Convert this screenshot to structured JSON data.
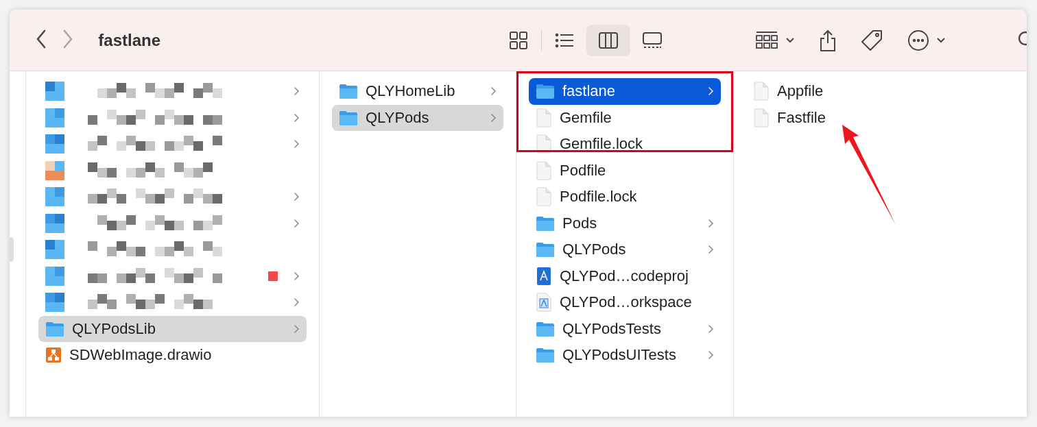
{
  "toolbar": {
    "title": "fastlane",
    "back_disabled": false,
    "forward_disabled": true,
    "views": [
      {
        "kind": "icons",
        "selected": false
      },
      {
        "kind": "list",
        "selected": false
      },
      {
        "kind": "columns",
        "selected": true
      },
      {
        "kind": "gallery",
        "selected": false
      }
    ]
  },
  "columns": [
    {
      "active": false,
      "items": [
        {
          "kind": "redacted",
          "expandable": true
        },
        {
          "kind": "redacted",
          "expandable": true
        },
        {
          "kind": "redacted",
          "expandable": true
        },
        {
          "kind": "redacted",
          "expandable": false
        },
        {
          "kind": "redacted",
          "expandable": true
        },
        {
          "kind": "redacted",
          "expandable": true
        },
        {
          "kind": "redacted",
          "expandable": false
        },
        {
          "kind": "redacted",
          "expandable": true,
          "color": "#f04848"
        },
        {
          "kind": "redacted",
          "expandable": true
        },
        {
          "kind": "folder",
          "name": "QLYPodsLib",
          "expandable": true,
          "selected": true
        },
        {
          "kind": "drawio",
          "name": "SDWebImage.drawio",
          "expandable": false,
          "selected": false
        }
      ]
    },
    {
      "active": false,
      "items": [
        {
          "kind": "folder",
          "name": "QLYHomeLib",
          "expandable": true,
          "selected": false
        },
        {
          "kind": "folder",
          "name": "QLYPods",
          "expandable": true,
          "selected": true
        }
      ]
    },
    {
      "active": true,
      "annotation_frame": true,
      "items": [
        {
          "kind": "folder",
          "name": "fastlane",
          "expandable": true,
          "selected": true
        },
        {
          "kind": "file",
          "name": "Gemfile",
          "expandable": false,
          "selected": false
        },
        {
          "kind": "file",
          "name": "Gemfile.lock",
          "expandable": false,
          "selected": false
        },
        {
          "kind": "file",
          "name": "Podfile",
          "expandable": false,
          "selected": false
        },
        {
          "kind": "file",
          "name": "Podfile.lock",
          "expandable": false,
          "selected": false
        },
        {
          "kind": "folder",
          "name": "Pods",
          "expandable": true,
          "selected": false
        },
        {
          "kind": "folder",
          "name": "QLYPods",
          "expandable": true,
          "selected": false
        },
        {
          "kind": "xcodeproj",
          "name": "QLYPod…codeproj",
          "expandable": false,
          "selected": false
        },
        {
          "kind": "workspace",
          "name": "QLYPod…orkspace",
          "expandable": false,
          "selected": false
        },
        {
          "kind": "folder",
          "name": "QLYPodsTests",
          "expandable": true,
          "selected": false
        },
        {
          "kind": "folder",
          "name": "QLYPodsUITests",
          "expandable": true,
          "selected": false
        }
      ]
    },
    {
      "active": false,
      "arrow": true,
      "items": [
        {
          "kind": "file",
          "name": "Appfile",
          "expandable": false,
          "selected": false
        },
        {
          "kind": "file",
          "name": "Fastfile",
          "expandable": false,
          "selected": false
        }
      ]
    }
  ]
}
